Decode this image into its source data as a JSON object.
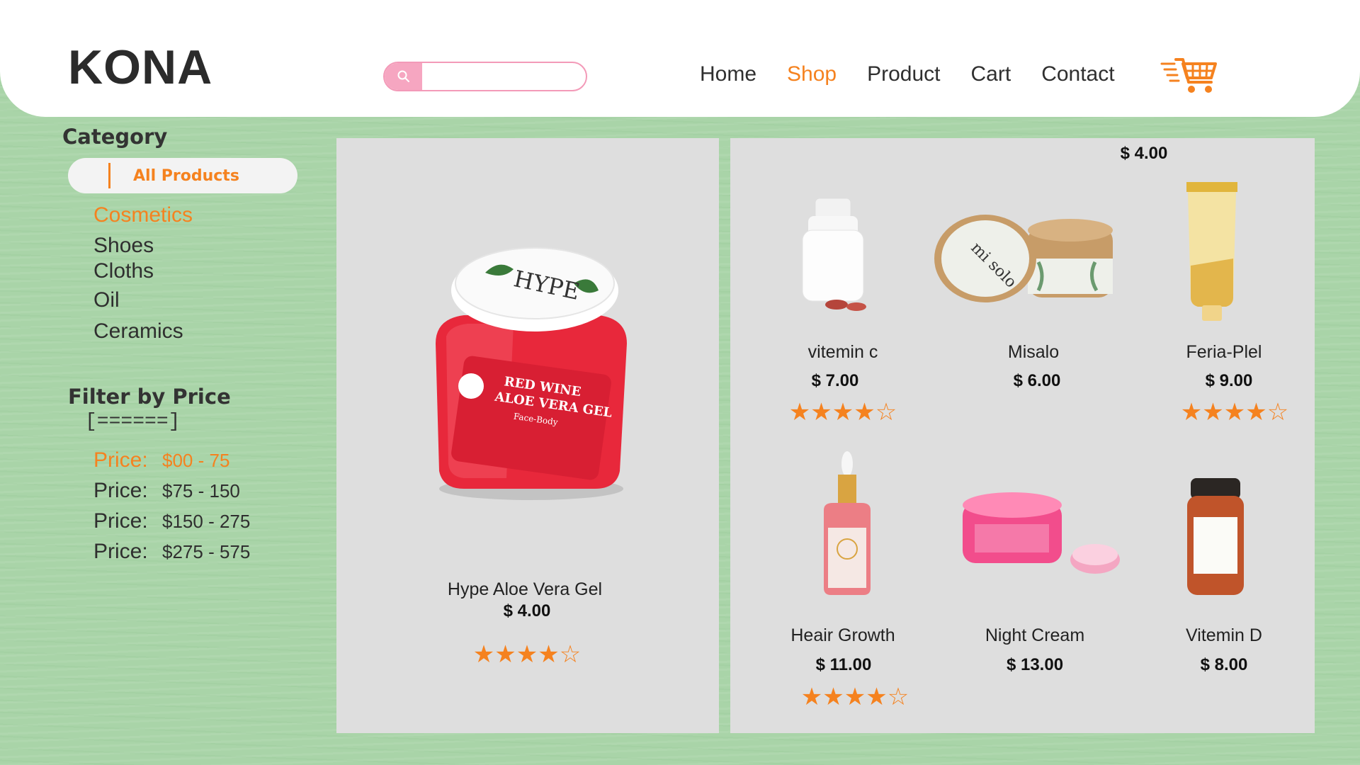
{
  "header": {
    "logo": "KONA",
    "search": {
      "placeholder": ""
    },
    "nav": [
      "Home",
      "Shop",
      "Product",
      "Cart",
      "Contact"
    ],
    "active_nav": "Shop",
    "cart_icon": "shopping-cart-icon"
  },
  "sidebar": {
    "category_title": "Category",
    "all_products_label": "All Products",
    "categories": [
      "Cosmetics",
      "Shoes",
      "Cloths",
      "Oil",
      "Ceramics"
    ],
    "active_category": "Cosmetics",
    "filter_title": "Filter by Price",
    "slider_text": "[======]",
    "price_label": "Price:",
    "price_ranges": [
      "$00 - 75",
      "$75 - 150",
      "$150 - 275",
      "$275 - 575"
    ],
    "active_price_range": "$00 - 75"
  },
  "featured": {
    "name": "Hype Aloe Vera Gel",
    "price": "$ 4.00",
    "rating": 4,
    "rating_max": 5
  },
  "grid": {
    "floating_price": "$ 4.00",
    "products": [
      {
        "name": "vitemin c",
        "price": "$ 7.00",
        "rating": 4
      },
      {
        "name": "Misalo",
        "price": "$ 6.00"
      },
      {
        "name": "Feria-Plel",
        "price": "$ 9.00",
        "rating": 4
      },
      {
        "name": "Heair Growth",
        "price": "$ 11.00",
        "rating": 4
      },
      {
        "name": "Night Cream",
        "price": "$ 13.00"
      },
      {
        "name": "Vitemin D",
        "price": "$ 8.00"
      }
    ]
  },
  "colors": {
    "accent": "#f5821f",
    "background": "#a9d4a8",
    "panel": "#dedede",
    "search_accent": "#f6a6c1"
  }
}
